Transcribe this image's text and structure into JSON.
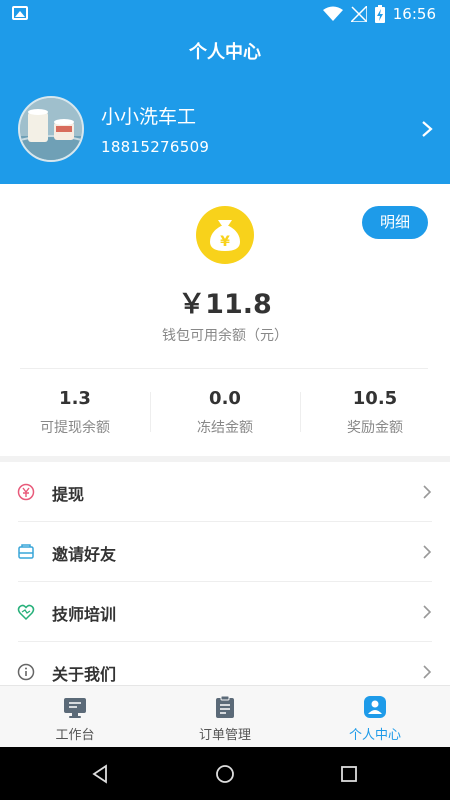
{
  "status_bar": {
    "time": "16:56",
    "icons": [
      "image-icon",
      "wifi-icon",
      "no-signal-icon",
      "battery-charging-icon"
    ]
  },
  "header": {
    "title": "个人中心",
    "profile": {
      "name": "小小洗车工",
      "phone": "18815276509"
    }
  },
  "wallet": {
    "detail_button": "明细",
    "icon": "money-bag-icon",
    "balance": "￥11.8",
    "balance_label": "钱包可用余额（元）",
    "stats": [
      {
        "value": "1.3",
        "label": "可提现余额"
      },
      {
        "value": "0.0",
        "label": "冻结金额"
      },
      {
        "value": "10.5",
        "label": "奖励金额"
      }
    ]
  },
  "menu": {
    "items": [
      {
        "label": "提现",
        "icon": "withdraw-icon",
        "color": "#e85a7a"
      },
      {
        "label": "邀请好友",
        "icon": "invite-icon",
        "color": "#39a5d8"
      },
      {
        "label": "技师培训",
        "icon": "training-icon",
        "color": "#27b07a"
      },
      {
        "label": "关于我们",
        "icon": "info-icon",
        "color": "#666666"
      }
    ]
  },
  "tabbar": {
    "tabs": [
      {
        "label": "工作台",
        "icon": "monitor-icon",
        "active": false
      },
      {
        "label": "订单管理",
        "icon": "clipboard-icon",
        "active": false
      },
      {
        "label": "个人中心",
        "icon": "user-icon",
        "active": true
      }
    ]
  },
  "colors": {
    "primary": "#1e9be9",
    "gold": "#f8d21b",
    "text": "#333333",
    "muted": "#888888"
  }
}
